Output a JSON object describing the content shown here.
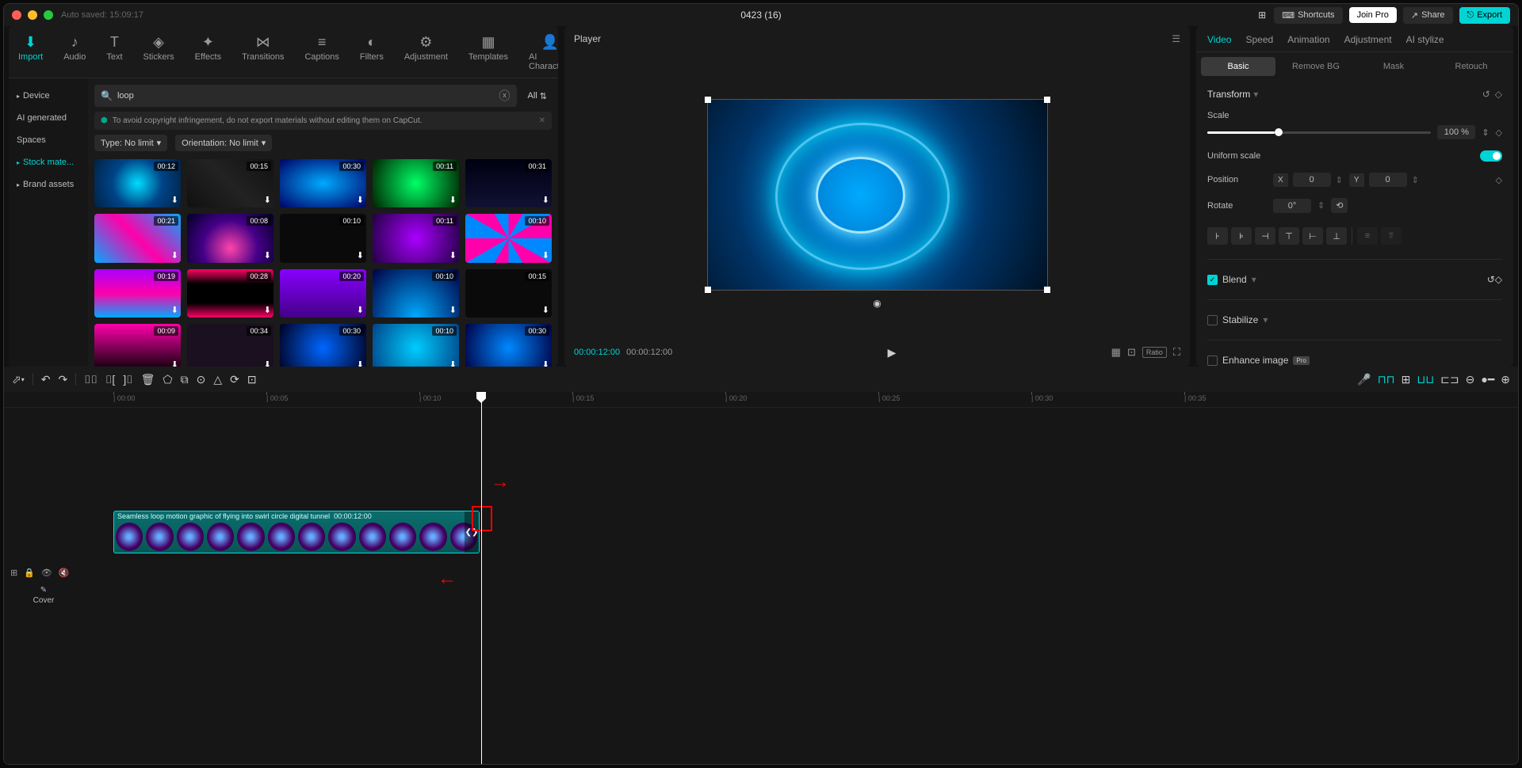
{
  "titlebar": {
    "autosave": "Auto saved: 15:09:17",
    "title": "0423 (16)",
    "shortcuts": "Shortcuts",
    "joinPro": "Join Pro",
    "share": "Share",
    "export": "Export"
  },
  "topTabs": [
    {
      "label": "Import",
      "active": true
    },
    {
      "label": "Audio"
    },
    {
      "label": "Text"
    },
    {
      "label": "Stickers"
    },
    {
      "label": "Effects"
    },
    {
      "label": "Transitions"
    },
    {
      "label": "Captions"
    },
    {
      "label": "Filters"
    },
    {
      "label": "Adjustment"
    },
    {
      "label": "Templates"
    },
    {
      "label": "AI Characters"
    }
  ],
  "mediaSide": [
    {
      "label": "Device",
      "caret": true
    },
    {
      "label": "AI generated"
    },
    {
      "label": "Spaces"
    },
    {
      "label": "Stock mate...",
      "active": true,
      "caret": true
    },
    {
      "label": "Brand assets",
      "caret": true
    }
  ],
  "search": {
    "value": "loop",
    "filterAll": "All"
  },
  "warning": "To avoid copyright infringement, do not export materials without editing them on CapCut.",
  "filters": {
    "type": "Type: No limit",
    "orientation": "Orientation: No limit"
  },
  "thumbs": [
    {
      "dur": "00:12",
      "bg": "radial-gradient(circle,#0df,#048,#024)"
    },
    {
      "dur": "00:15",
      "bg": "linear-gradient(45deg,#111,#222,#111)"
    },
    {
      "dur": "00:30",
      "bg": "radial-gradient(ellipse,#0af,#006)"
    },
    {
      "dur": "00:11",
      "bg": "radial-gradient(circle,#0f6,#020)"
    },
    {
      "dur": "00:31",
      "bg": "linear-gradient(#001,#113)"
    },
    {
      "dur": "00:21",
      "bg": "linear-gradient(45deg,#0af,#f0a,#0af)"
    },
    {
      "dur": "00:08",
      "bg": "radial-gradient(circle at 50% 70%,#f4a,#408,#002)"
    },
    {
      "dur": "00:10",
      "bg": "#0a0a0a"
    },
    {
      "dur": "00:11",
      "bg": "radial-gradient(circle,#a0f,#204)"
    },
    {
      "dur": "00:10",
      "bg": "repeating-conic-gradient(#f0a 0 30deg,#08f 30deg 60deg)"
    },
    {
      "dur": "00:19",
      "bg": "linear-gradient(#a0f,#f0a,#0af)"
    },
    {
      "dur": "00:28",
      "bg": "linear-gradient(#f06,#000 30%,#000 70%,#f06)"
    },
    {
      "dur": "00:20",
      "bg": "linear-gradient(#80f,#408)"
    },
    {
      "dur": "00:10",
      "bg": "radial-gradient(ellipse at 50% 100%,#0af,#004)"
    },
    {
      "dur": "00:15",
      "bg": "#0a0a0a"
    },
    {
      "dur": "00:09",
      "bg": "linear-gradient(#f0a,#000)"
    },
    {
      "dur": "00:34",
      "bg": "#1a1020"
    },
    {
      "dur": "00:30",
      "bg": "radial-gradient(circle,#06f,#002)"
    },
    {
      "dur": "00:10",
      "bg": "radial-gradient(circle,#0cf,#048)"
    },
    {
      "dur": "00:30",
      "bg": "radial-gradient(circle,#08f,#004)"
    }
  ],
  "player": {
    "header": "Player",
    "timeCurrent": "00:00:12:00",
    "timeTotal": "00:00:12:00",
    "ratio": "Ratio"
  },
  "inspector": {
    "tabs": [
      "Video",
      "Speed",
      "Animation",
      "Adjustment",
      "AI stylize"
    ],
    "activeTab": 0,
    "subTabs": [
      "Basic",
      "Remove BG",
      "Mask",
      "Retouch"
    ],
    "activeSub": 0,
    "transform": "Transform",
    "scale": {
      "label": "Scale",
      "value": "100 %"
    },
    "uniformScale": "Uniform scale",
    "position": {
      "label": "Position",
      "x": "0",
      "y": "0"
    },
    "rotate": {
      "label": "Rotate",
      "value": "0°"
    },
    "blend": "Blend",
    "stabilize": "Stabilize",
    "enhance": "Enhance image",
    "proBadge": "Pro"
  },
  "timeline": {
    "ticks": [
      "00:00",
      "00:05",
      "00:10",
      "00:15",
      "00:20",
      "00:25",
      "00:30",
      "00:35"
    ],
    "cover": "Cover",
    "clipLabel": "Seamless loop motion graphic of flying into swirl circle digital tunnel",
    "clipDuration": "00:00:12:00"
  }
}
